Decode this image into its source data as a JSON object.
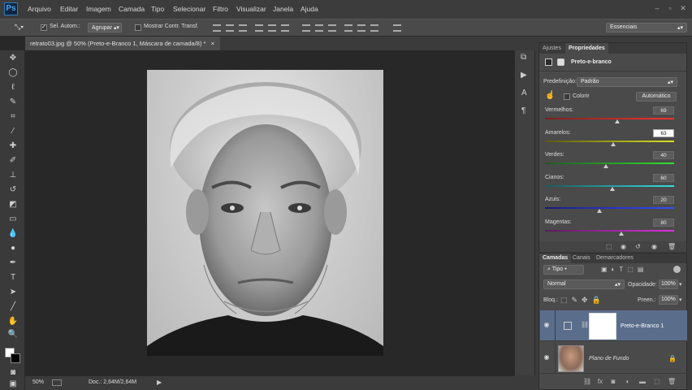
{
  "app": {
    "logo": "Ps"
  },
  "menu": [
    "Arquivo",
    "Editar",
    "Imagem",
    "Camada",
    "Tipo",
    "Selecionar",
    "Filtro",
    "Visualizar",
    "Janela",
    "Ajuda"
  ],
  "options": {
    "auto_select_label": "Sel. Autom.:",
    "auto_select_value": "Agrupar",
    "transform_label": "Mostrar Contr. Transf.",
    "workspace": "Essenciais"
  },
  "document": {
    "tab_title": "retrato03.jpg @ 50% (Preto-e-Branco 1, Máscara de camada/8) *",
    "close": "×"
  },
  "status": {
    "zoom": "50%",
    "doc": "Doc.: 2,64M/2,64M"
  },
  "properties": {
    "tabs": [
      "Ajustes",
      "Propriedades"
    ],
    "title": "Preto-e-branco",
    "preset_label": "Predefinição:",
    "preset_value": "Padrão",
    "tint_label": "Colorir",
    "auto_button": "Automático",
    "sliders": [
      {
        "label": "Vermelhos:",
        "value": "69",
        "fraction": 0.56,
        "colors": [
          "#7a2020",
          "#ff3030"
        ]
      },
      {
        "label": "Amarelos:",
        "value": "63",
        "fraction": 0.53,
        "colors": [
          "#5a5a10",
          "#e0e020"
        ]
      },
      {
        "label": "Verdes:",
        "value": "40",
        "fraction": 0.47,
        "colors": [
          "#205a20",
          "#30e030"
        ]
      },
      {
        "label": "Cianos:",
        "value": "60",
        "fraction": 0.52,
        "colors": [
          "#1a5a5a",
          "#30e0e0"
        ]
      },
      {
        "label": "Azuis:",
        "value": "20",
        "fraction": 0.42,
        "colors": [
          "#1a1a7a",
          "#3050ff"
        ]
      },
      {
        "label": "Magentas:",
        "value": "80",
        "fraction": 0.59,
        "colors": [
          "#5a1a5a",
          "#e030e0"
        ]
      }
    ]
  },
  "layers": {
    "tabs": [
      "Camadas",
      "Canais",
      "Demarcadores"
    ],
    "filter_label": "Tipo",
    "blend_mode": "Normal",
    "opacity_label": "Opacidade:",
    "opacity_value": "100%",
    "lock_label": "Bloq.:",
    "fill_label": "Preen.:",
    "fill_value": "100%",
    "items": [
      {
        "name": "Preto-e-Branco 1",
        "selected": true
      },
      {
        "name": "Plano de Fundo",
        "selected": false
      }
    ]
  },
  "colors": {
    "accent": "#5a6e8c",
    "photo_bg": "#d0d0d0"
  }
}
